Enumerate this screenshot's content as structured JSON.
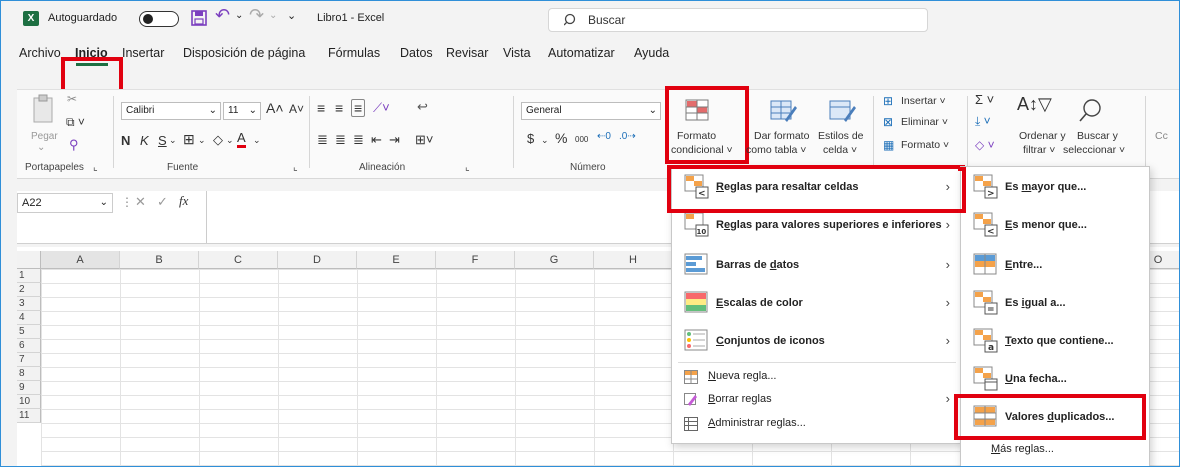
{
  "titlebar": {
    "app_icon": "X",
    "autosave_label": "Autoguardado",
    "qat_more": "⌄",
    "doc_title": "Libro1  -  Excel",
    "search_placeholder": "Buscar"
  },
  "menubar": {
    "items": [
      "Archivo",
      "Inicio",
      "Insertar",
      "Disposición de página",
      "Fórmulas",
      "Datos",
      "Revisar",
      "Vista",
      "Automatizar",
      "Ayuda"
    ],
    "active": "Inicio"
  },
  "ribbon": {
    "clipboard": {
      "paste": "Pegar",
      "group": "Portapapeles"
    },
    "font": {
      "name": "Calibri",
      "size": "11",
      "bold": "N",
      "italic": "K",
      "underline": "S",
      "group": "Fuente"
    },
    "alignment": {
      "group": "Alineación"
    },
    "number": {
      "format": "General",
      "currency": "$",
      "percent": "%",
      "thousands": "000",
      "group": "Número"
    },
    "styles": {
      "conditional_1": "Formato",
      "conditional_2": "condicional ˅",
      "table_1": "Dar formato",
      "table_2": "como tabla ˅",
      "cell_1": "Estilos de",
      "cell_2": "celda ˅"
    },
    "cells": {
      "insert": "Insertar  ˅",
      "delete": "Eliminar  ˅",
      "format": "Formato ˅"
    },
    "editing": {
      "sum": "Σ ˅",
      "sort_1": "Ordenar y",
      "sort_2": "filtrar ˅",
      "find_1": "Buscar y",
      "find_2": "seleccionar ˅",
      "cut_off": "Cc"
    }
  },
  "formula_bar": {
    "namebox": "A22",
    "fx": "fx"
  },
  "grid": {
    "columns": [
      "A",
      "B",
      "C",
      "D",
      "E",
      "F",
      "G",
      "H",
      "O"
    ],
    "rows": [
      "1",
      "2",
      "3",
      "4",
      "5",
      "6",
      "7",
      "8",
      "9",
      "10",
      "11"
    ]
  },
  "menu_main": {
    "items": [
      {
        "pre": "",
        "u": "R",
        "post": "eglas para resaltar celdas",
        "arrow": "›"
      },
      {
        "pre": "R",
        "u": "e",
        "post": "glas para valores superiores e inferiores",
        "arrow": "›"
      },
      {
        "pre": "Barras de ",
        "u": "d",
        "post": "atos",
        "arrow": "›"
      },
      {
        "pre": "",
        "u": "E",
        "post": "scalas de color",
        "arrow": "›"
      },
      {
        "pre": "",
        "u": "C",
        "post": "onjuntos de iconos",
        "arrow": "›"
      }
    ],
    "small_items": [
      {
        "pre": "",
        "u": "N",
        "post": "ueva regla..."
      },
      {
        "pre": "",
        "u": "B",
        "post": "orrar reglas",
        "arrow": "›"
      },
      {
        "pre": "",
        "u": "A",
        "post": "dministrar reglas..."
      }
    ]
  },
  "menu_sub": {
    "items": [
      {
        "pre": "Es ",
        "u": "m",
        "post": "ayor que..."
      },
      {
        "pre": "",
        "u": "E",
        "post": "s menor que..."
      },
      {
        "pre": "",
        "u": "E",
        "post": "ntre..."
      },
      {
        "pre": "Es ",
        "u": "i",
        "post": "gual a..."
      },
      {
        "pre": "",
        "u": "T",
        "post": "exto que contiene..."
      },
      {
        "pre": "",
        "u": "U",
        "post": "na fecha..."
      },
      {
        "pre": "Valores ",
        "u": "d",
        "post": "uplicados..."
      }
    ],
    "more": {
      "pre": "",
      "u": "M",
      "post": "ás reglas..."
    }
  },
  "colors": {
    "highlight": "#e1000f",
    "excel_green": "#1d6f42",
    "accent_blue": "#2f8fd8"
  }
}
